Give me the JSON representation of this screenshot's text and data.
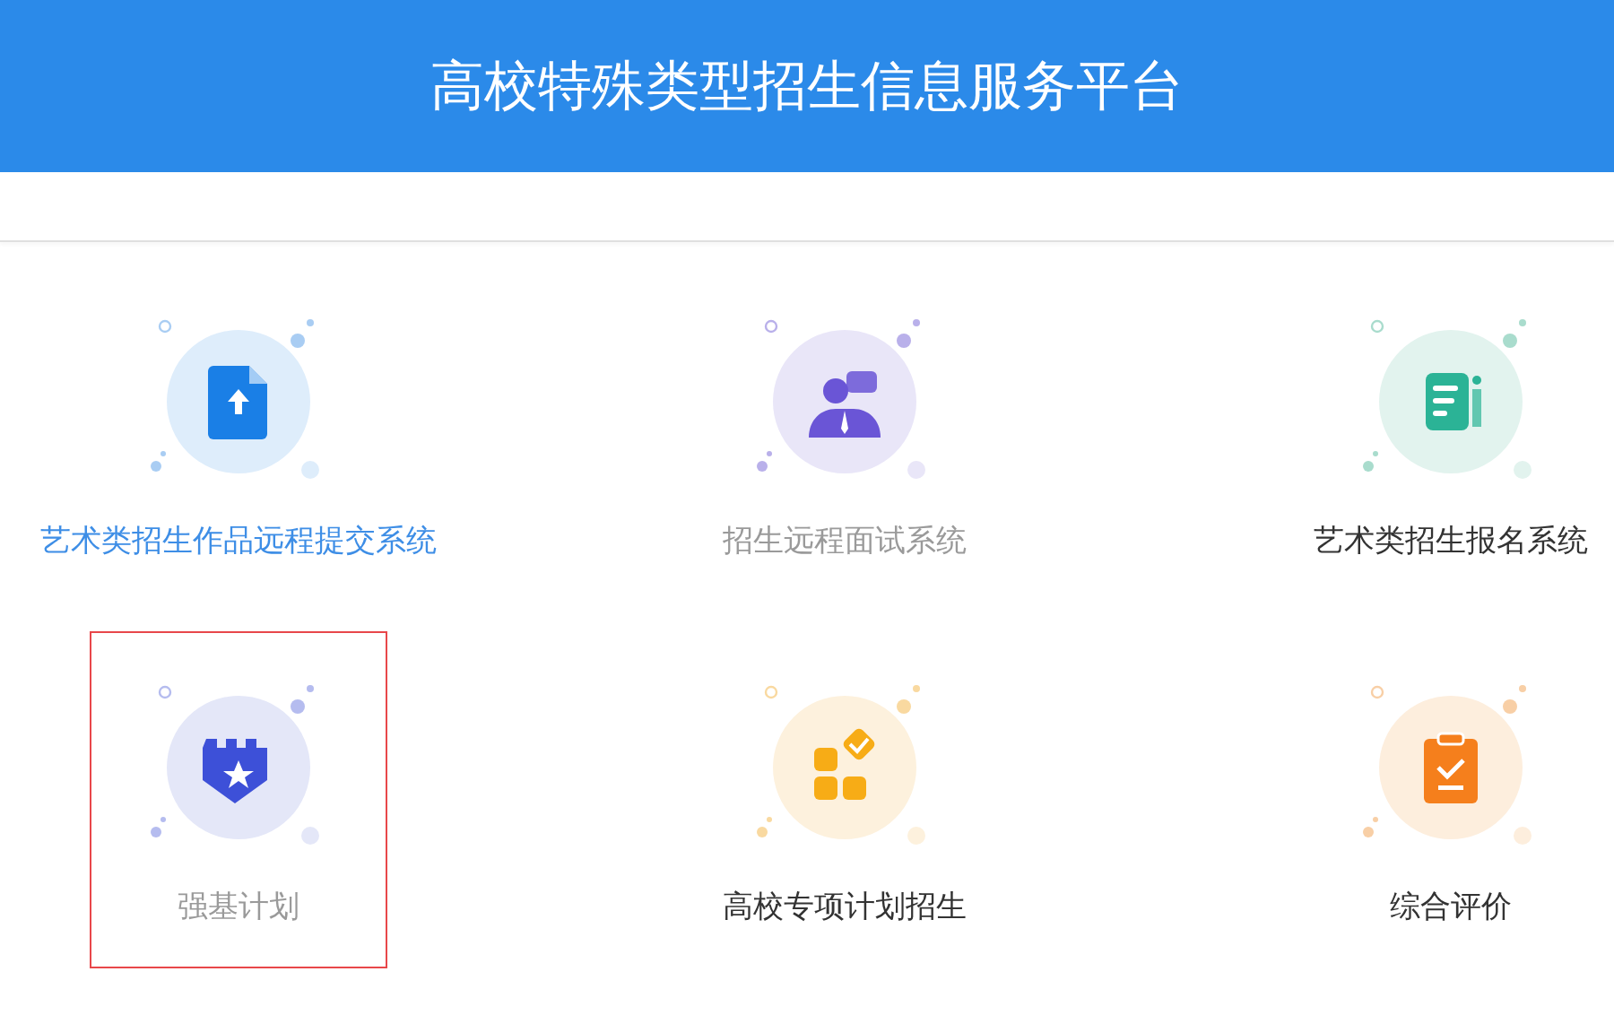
{
  "header": {
    "title": "高校特殊类型招生信息服务平台"
  },
  "systems": [
    {
      "label": "艺术类招生作品远程提交系统",
      "kind": "upload",
      "selected": true,
      "disabled": false,
      "highlighted": false
    },
    {
      "label": "招生远程面试系统",
      "kind": "interview",
      "selected": false,
      "disabled": true,
      "highlighted": false
    },
    {
      "label": "艺术类招生报名系统",
      "kind": "register",
      "selected": false,
      "disabled": false,
      "highlighted": false
    },
    {
      "label": "强基计划",
      "kind": "shield",
      "selected": false,
      "disabled": true,
      "highlighted": true
    },
    {
      "label": "高校专项计划招生",
      "kind": "apps",
      "selected": false,
      "disabled": false,
      "highlighted": false
    },
    {
      "label": "综合评价",
      "kind": "evaluate",
      "selected": false,
      "disabled": false,
      "highlighted": false
    }
  ]
}
